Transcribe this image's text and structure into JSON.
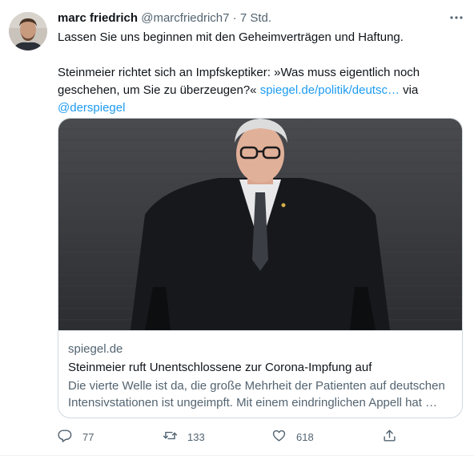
{
  "tweet": {
    "author_name": "marc friedrich",
    "author_handle": "@marcfriedrich7",
    "separator": "·",
    "time": "7 Std.",
    "text_line1": "Lassen Sie uns beginnen mit den Geheimverträgen und Haftung.",
    "text_para2": "Steinmeier richtet sich an Impfskeptiker: »Was muss eigentlich noch geschehen, um Sie zu überzeugen?« ",
    "link_url": "spiegel.de/politik/deutsc…",
    "via_word": " via",
    "mention": "@derspiegel"
  },
  "card": {
    "domain": "spiegel.de",
    "title": "Steinmeier ruft Unentschlossene zur Corona-Impfung auf",
    "description": "Die vierte Welle ist da, die große Mehrheit der Patienten auf deutschen Intensivstationen ist ungeimpft. Mit einem eindringlichen Appell hat …"
  },
  "actions": {
    "reply_count": "77",
    "retweet_count": "133",
    "like_count": "618"
  },
  "icons": {
    "more": "more-dots-icon",
    "reply": "reply-icon",
    "retweet": "retweet-icon",
    "like": "heart-icon",
    "share": "share-icon"
  },
  "colors": {
    "accent": "#1d9bf0",
    "text": "#0f1419",
    "secondary": "#536471",
    "border": "#cfd9de"
  }
}
